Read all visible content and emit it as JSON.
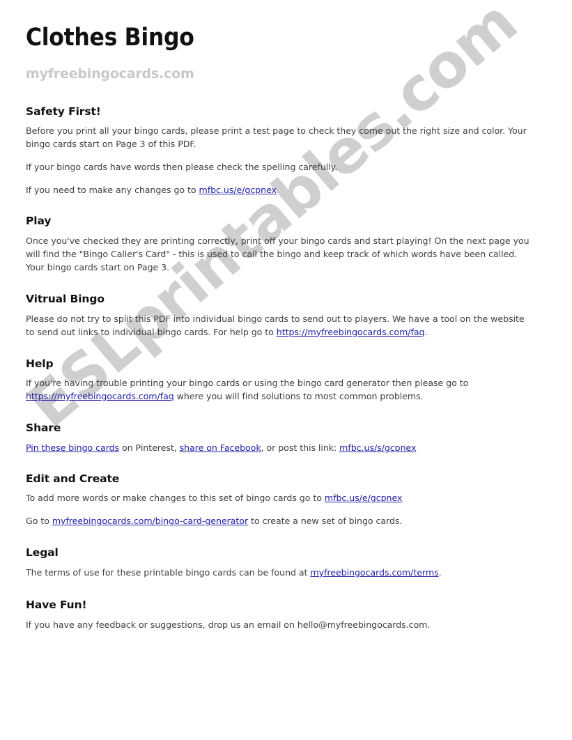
{
  "document": {
    "title": "Clothes Bingo",
    "site": "myfreebingocards.com",
    "watermark": "ESLprintables.com",
    "watermark_color": "#cfcfcf",
    "link_color": "#2222a8",
    "body_color": "#3f3f3f",
    "heading_color": "#111111",
    "subtitle_color": "#c8c8c8"
  },
  "sections": {
    "safety": {
      "heading": "Safety First!",
      "p1": "Before you print all your bingo cards, please print a test page to check they come out the right size and color. Your bingo cards start on Page 3 of this PDF.",
      "p2": "If your bingo cards have words then please check the spelling carefully.",
      "p3_before": "If you need to make any changes go to ",
      "p3_link": "mfbc.us/e/gcpnex",
      "p3_after": ""
    },
    "play": {
      "heading": "Play",
      "p1": "Once you've checked they are printing correctly, print off your bingo cards and start playing! On the next page you will find the \"Bingo Caller's Card\" - this is used to call the bingo and keep track of which words have been called. Your bingo cards start on Page 3."
    },
    "virtual": {
      "heading": "Vitrual Bingo",
      "p1_before": "Please do not try to split this PDF into individual bingo cards to send out to players. We have a tool on the website to send out links to individual bingo cards. For help go to ",
      "p1_link": "https://myfreebingocards.com/faq",
      "p1_after": "."
    },
    "help": {
      "heading": "Help",
      "p1_before": "If you're having trouble printing your bingo cards or using the bingo card generator then please go to ",
      "p1_link": "https://myfreebingocards.com/faq",
      "p1_after": " where you will find solutions to most common problems."
    },
    "share": {
      "heading": "Share",
      "link_pinterest": "Pin these bingo cards",
      "mid1": " on Pinterest, ",
      "link_facebook": "share on Facebook",
      "mid2": ", or post this link: ",
      "link_short": "mfbc.us/s/gcpnex"
    },
    "edit": {
      "heading": "Edit and Create",
      "p1_before": "To add more words or make changes to this set of bingo cards go to ",
      "p1_link": "mfbc.us/e/gcpnex",
      "p1_after": "",
      "p2_before": "Go to ",
      "p2_link": "myfreebingocards.com/bingo-card-generator",
      "p2_after": " to create a new set of bingo cards."
    },
    "legal": {
      "heading": "Legal",
      "p1_before": "The terms of use for these printable bingo cards can be found at ",
      "p1_link": "myfreebingocards.com/terms",
      "p1_after": "."
    },
    "fun": {
      "heading": "Have Fun!",
      "p1": "If you have any feedback or suggestions, drop us an email on hello@myfreebingocards.com."
    }
  }
}
